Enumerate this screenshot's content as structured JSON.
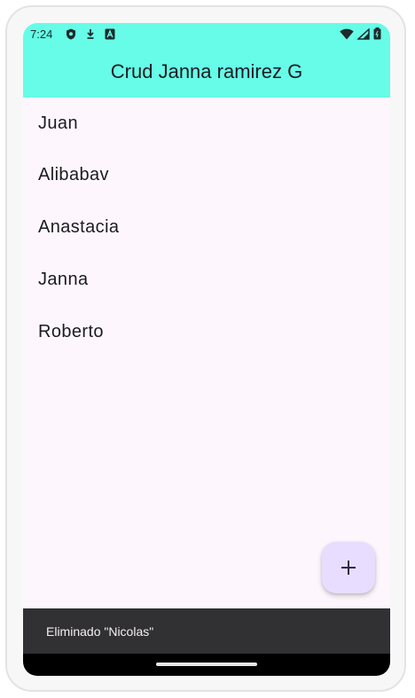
{
  "status_bar": {
    "time": "7:24",
    "left_icons": [
      "shield-icon",
      "download-icon",
      "app-a-icon"
    ],
    "right_icons": [
      "wifi-icon",
      "signal-icon",
      "battery-icon"
    ]
  },
  "app_bar": {
    "title": "Crud Janna ramirez G",
    "background_color": "#66fce8"
  },
  "list": {
    "items": [
      {
        "label": "Juan"
      },
      {
        "label": "Alibabav"
      },
      {
        "label": "Anastacia"
      },
      {
        "label": "Janna"
      },
      {
        "label": "Roberto"
      }
    ]
  },
  "fab": {
    "icon": "plus-icon",
    "background_color": "#e9ddff"
  },
  "snackbar": {
    "message": "Eliminado \"Nicolas\""
  },
  "nav_bar": {
    "handle": "gesture-handle"
  }
}
